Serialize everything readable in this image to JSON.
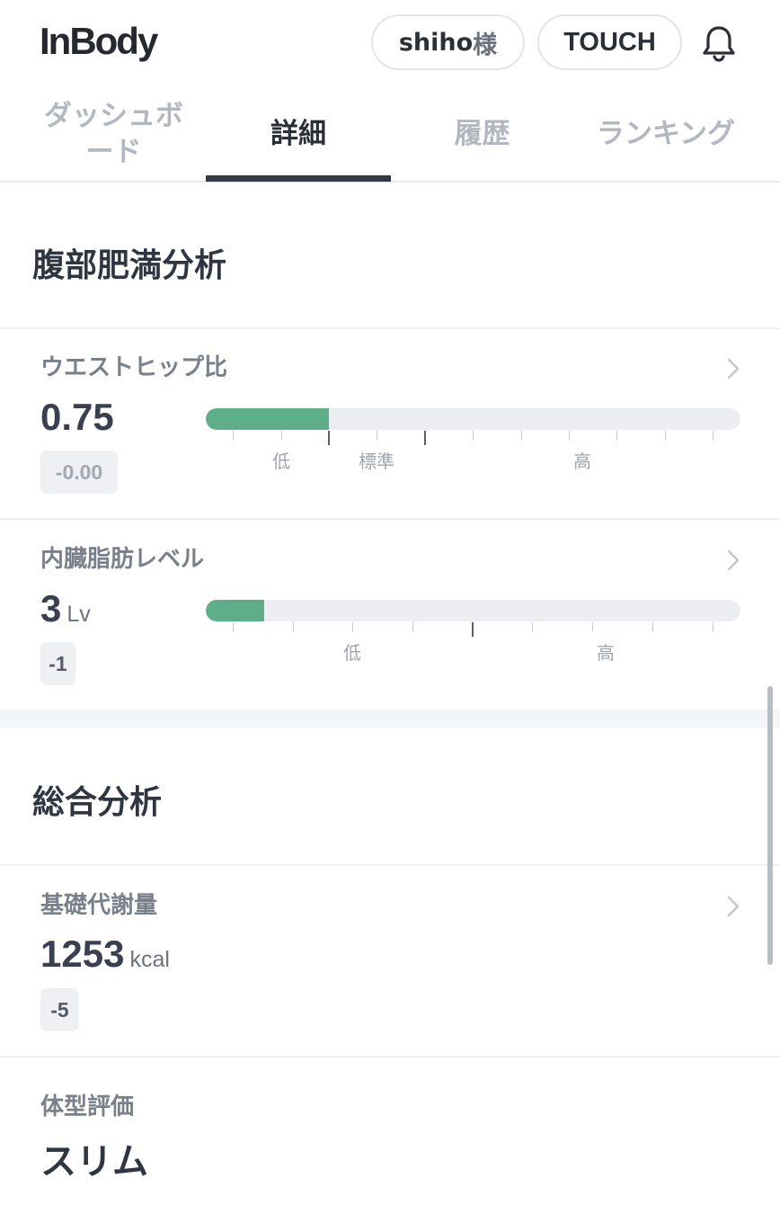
{
  "header": {
    "logo": "InBody",
    "user_name": "shiho",
    "user_suffix": "様",
    "touch_label": "TOUCH",
    "bell_icon": "bell-icon"
  },
  "tabs": [
    {
      "label": "ダッシュボード",
      "active": false
    },
    {
      "label": "詳細",
      "active": true
    },
    {
      "label": "履歴",
      "active": false
    },
    {
      "label": "ランキング",
      "active": false
    }
  ],
  "abdominal": {
    "title": "腹部肥満分析",
    "whr": {
      "label": "ウエストヒップ比",
      "value": "0.75",
      "change": "-0.00",
      "bar_fill_fraction": 0.23,
      "scale_labels": {
        "low": "低",
        "standard": "標準",
        "high": "高"
      }
    },
    "visceral": {
      "label": "内臓脂肪レベル",
      "value": "3",
      "unit": "Lv",
      "change": "-1",
      "bar_fill_fraction": 0.11,
      "scale_labels": {
        "low": "低",
        "high": "高"
      }
    }
  },
  "overall": {
    "title": "総合分析",
    "bmr": {
      "label": "基礎代謝量",
      "value": "1253",
      "unit": "kcal",
      "change": "-5"
    },
    "body_type": {
      "label": "体型評価",
      "value": "スリム"
    }
  },
  "colors": {
    "accent_green": "#5fae8a",
    "text_dark": "#2f3541",
    "text_muted": "#7a808b"
  }
}
